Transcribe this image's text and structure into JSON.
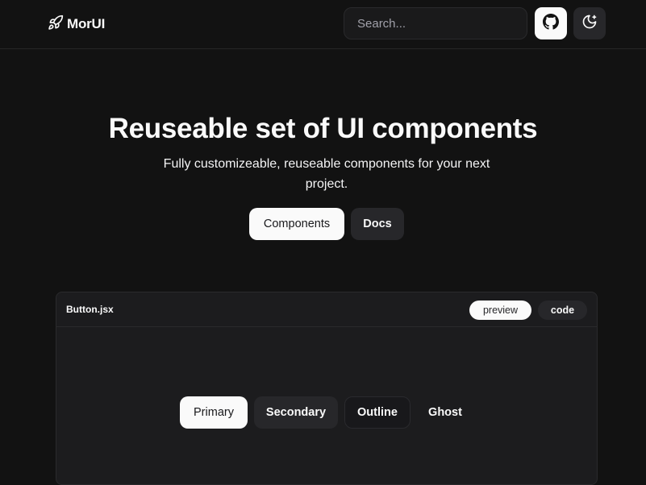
{
  "app": {
    "name": "MorUI",
    "search_placeholder": "Search..."
  },
  "icons": {
    "logo": "rocket-icon",
    "github": "github-icon",
    "theme": "moon-sparkle-icon"
  },
  "hero": {
    "title": "Reuseable set of UI components",
    "subtitle": "Fully customizeable, reuseable components for your next project.",
    "buttons": {
      "components": "Components",
      "docs": "Docs"
    }
  },
  "preview_card": {
    "file_name": "Button.jsx",
    "tabs": {
      "preview": "preview",
      "code": "code"
    },
    "demo_buttons": {
      "primary": "Primary",
      "secondary": "Secondary",
      "outline": "Outline",
      "ghost": "Ghost"
    }
  },
  "colors": {
    "background": "#121212",
    "surface": "#1c1c1e",
    "primary": "#fafafa",
    "secondary": "#27272a"
  }
}
